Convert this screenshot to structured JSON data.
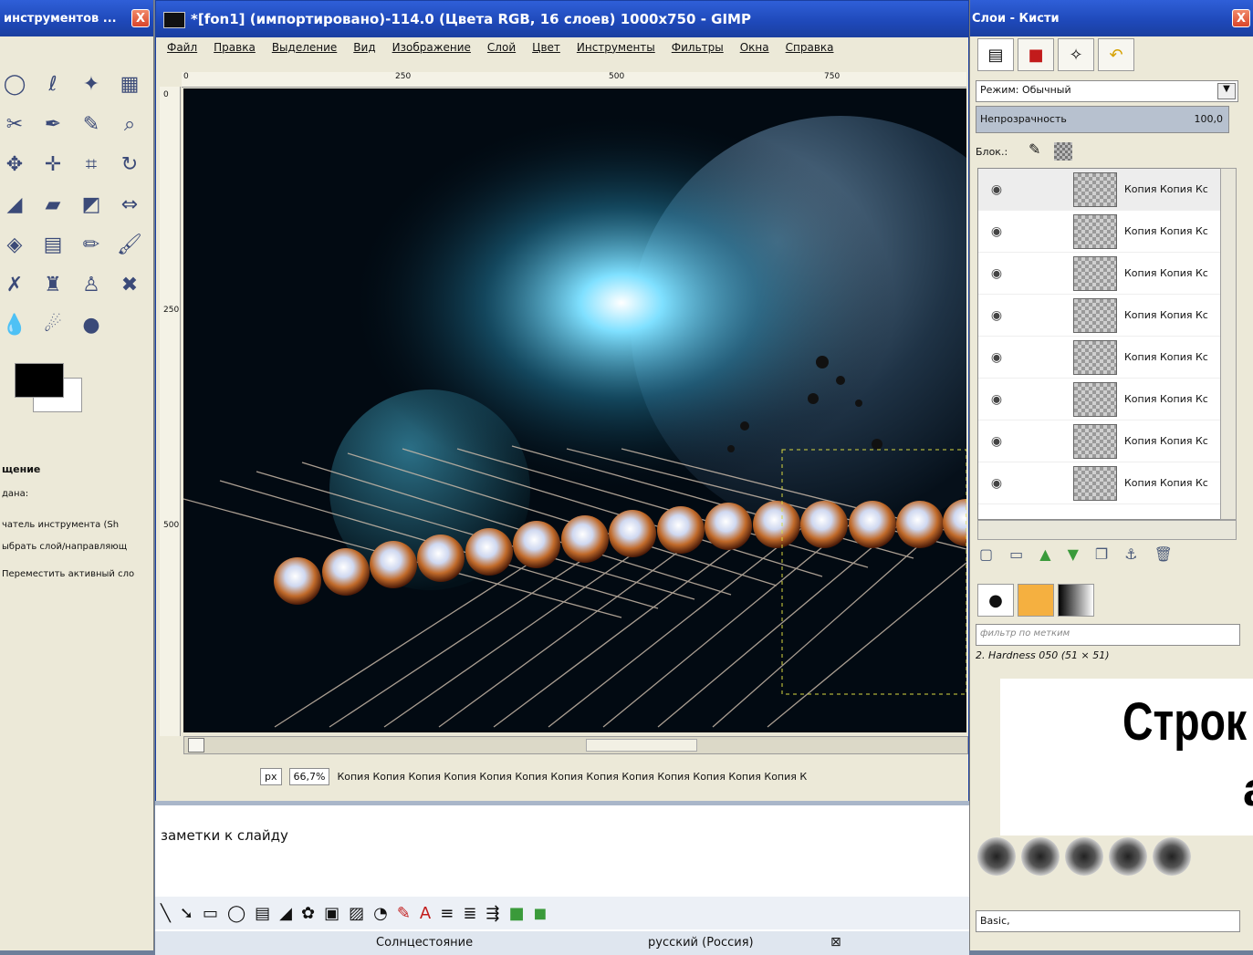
{
  "toolbox": {
    "title": "инструментов ...",
    "close": "X",
    "options_title": "щение",
    "options_lines": [
      "дана:",
      "чатель инструмента (Sh",
      "ыбрать слой/направляющ",
      "Переместить активный сло"
    ]
  },
  "main": {
    "title": "*[fon1] (импортировано)-114.0 (Цвета RGB, 16 слоев) 1000x750 - GIMP",
    "menu": [
      "Файл",
      "Правка",
      "Выделение",
      "Вид",
      "Изображение",
      "Слой",
      "Цвет",
      "Инструменты",
      "Фильтры",
      "Окна",
      "Справка"
    ],
    "ruler_h": [
      "0",
      "250",
      "500",
      "750"
    ],
    "ruler_v": [
      "0",
      "250",
      "500"
    ],
    "unit": "px",
    "zoom": "66,7%",
    "status": "Копия Копия Копия Копия Копия Копия Копия Копия Копия Копия Копия Копия Копия К"
  },
  "notes": {
    "label": "заметки к слайду",
    "status_left": "Солнцестояние",
    "status_lang": "русский (Россия)"
  },
  "layers": {
    "title": "Слои - Кисти",
    "close": "X",
    "mode_label": "Режим: Обычный",
    "opacity_label": "Непрозрачность",
    "opacity_value": "100,0",
    "lock_label": "Блок.:",
    "items": [
      "Копия Копия Кс",
      "Копия Копия Кс",
      "Копия Копия Кс",
      "Копия Копия Кс",
      "Копия Копия Кс",
      "Копия Копия Кс",
      "Копия Копия Кс",
      "Копия Копия Кс"
    ],
    "brush_filter": "фильтр по метким",
    "brush_name": "2. Hardness 050 (51 × 51)",
    "preset": "Basic,"
  },
  "overlay": {
    "line1": "Строк",
    "line2": "а"
  }
}
